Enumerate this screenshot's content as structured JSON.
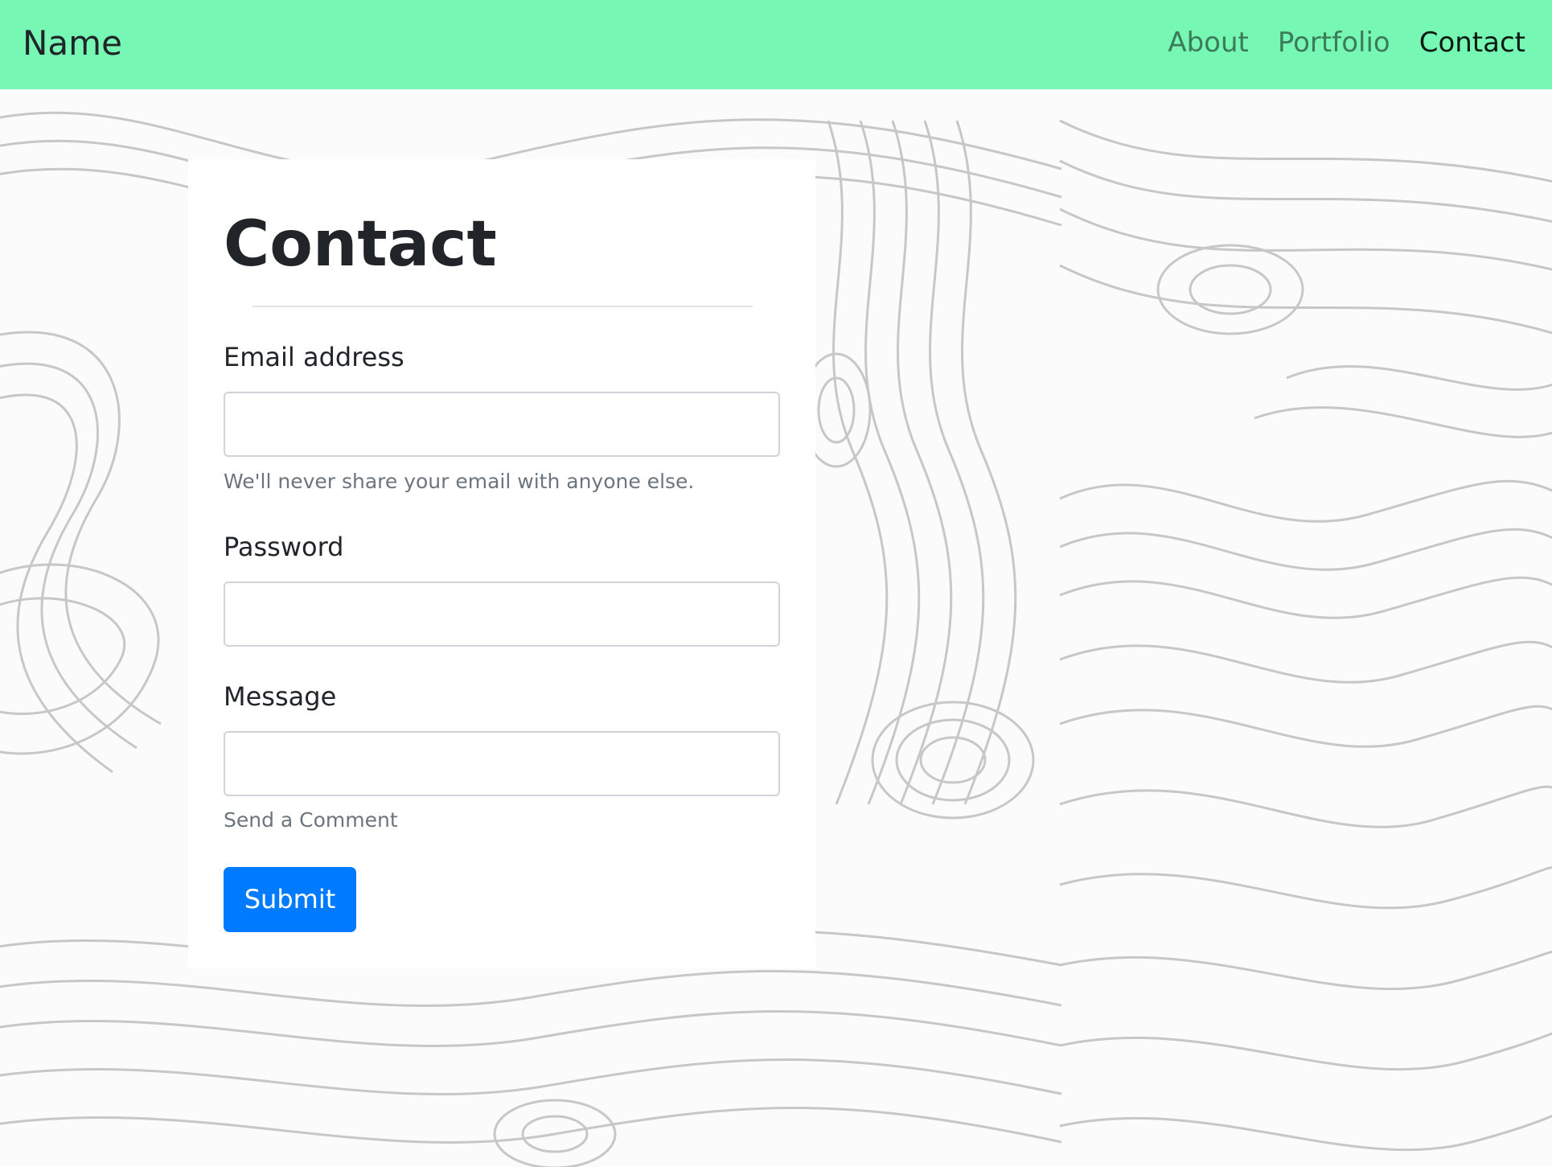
{
  "navbar": {
    "brand": "Name",
    "links": [
      {
        "label": "About",
        "active": false
      },
      {
        "label": "Portfolio",
        "active": false
      },
      {
        "label": "Contact",
        "active": true
      }
    ],
    "background_color": "#76f7b3"
  },
  "page": {
    "title": "Contact",
    "background": "topographic contour line pattern"
  },
  "form": {
    "email": {
      "label": "Email address",
      "value": "",
      "help": "We'll never share your email with anyone else."
    },
    "password": {
      "label": "Password",
      "value": ""
    },
    "message": {
      "label": "Message",
      "value": "",
      "help": "Send a Comment"
    },
    "submit_label": "Submit",
    "submit_color": "#007bff"
  }
}
